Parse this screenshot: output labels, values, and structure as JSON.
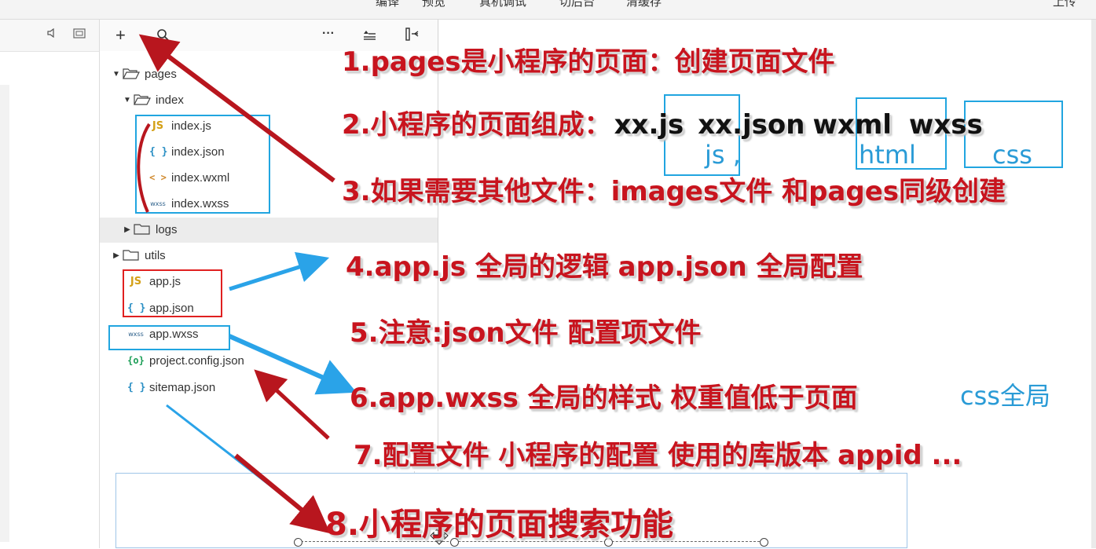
{
  "menu": {
    "items": [
      "编译",
      "预览",
      "真机调试",
      "切后台",
      "清缓存"
    ],
    "upload": "上传"
  },
  "toolbar": {
    "add_icon": "+",
    "search_icon": "search",
    "more_icon": "···",
    "sort_icon": "sort",
    "collapse_icon": "collapse"
  },
  "tree": {
    "pages": "pages",
    "index": "index",
    "index_js": "index.js",
    "index_json": "index.json",
    "index_wxml": "index.wxml",
    "index_wxss": "index.wxss",
    "logs": "logs",
    "utils": "utils",
    "app_js": "app.js",
    "app_json": "app.json",
    "app_wxss": "app.wxss",
    "project_config": "project.config.json",
    "sitemap": "sitemap.json"
  },
  "icons": {
    "js": "JS",
    "json": "{ }",
    "wxml": "< >",
    "wxss": "wxss",
    "config": "{o}"
  },
  "notes": {
    "n1": "1.pages是小程序的页面：创建页面文件",
    "n2_prefix": "2.小程序的页面组成：",
    "n2_js": "xx.js",
    "n2_json": "xx.json",
    "n2_wxml": "wxml",
    "n2_wxss": "wxss",
    "n3": "3.如果需要其他文件：images文件 和pages同级创建",
    "n4": "4.app.js 全局的逻辑   app.json 全局配置",
    "n5": "5.注意:json文件 配置项文件",
    "n6": "6.app.wxss 全局的样式 权重值低于页面",
    "n7": "7.配置文件 小程序的配置 使用的库版本 appid ...",
    "n8": "8.小程序的页面搜索功能"
  },
  "labels": {
    "js": "js ,",
    "html": "html",
    "css": "css",
    "css_global": "css全局"
  },
  "colors": {
    "annotation_red": "#c8141e",
    "annotation_blue": "#2a9bd6",
    "box_red": "#e02020",
    "box_blue": "#21a5e0"
  }
}
